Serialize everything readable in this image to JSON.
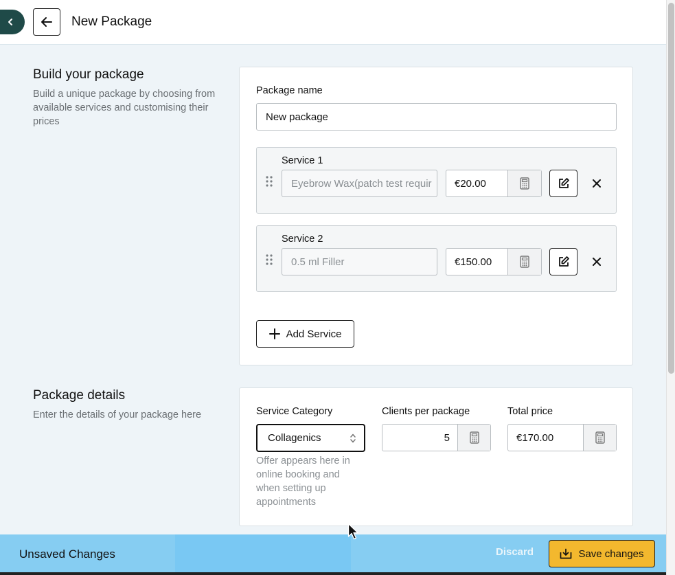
{
  "header": {
    "title": "New Package"
  },
  "build_section": {
    "title": "Build your package",
    "description": "Build a unique package by choosing from available services and customising their prices"
  },
  "package_name": {
    "label": "Package name",
    "value": "New package"
  },
  "services": [
    {
      "label": "Service 1",
      "name": "Eyebrow Wax(patch test requir",
      "price": "€20.00"
    },
    {
      "label": "Service 2",
      "name": "0.5 ml Filler",
      "price": "€150.00"
    }
  ],
  "add_service_label": "Add Service",
  "details_section": {
    "title": "Package details",
    "description": "Enter the details of your package here"
  },
  "details": {
    "category_label": "Service Category",
    "category_value": "Collagenics",
    "category_hint": "Offer appears here in online booking and when setting up appointments",
    "clients_label": "Clients per package",
    "clients_value": "5",
    "total_label": "Total price",
    "total_value": "€170.00"
  },
  "unsaved_bar": {
    "message": "Unsaved Changes",
    "discard_label": "Discard",
    "save_label": "Save changes"
  },
  "colors": {
    "accent": "#1f4a48",
    "unsaved_bar": "#86cdf2",
    "save_button": "#f3b82e"
  }
}
